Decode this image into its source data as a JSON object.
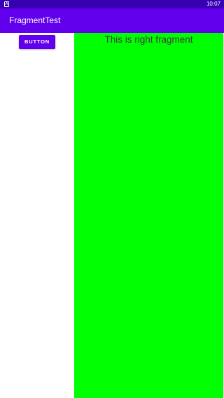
{
  "status_bar": {
    "time": "10:07",
    "left_icon": "A",
    "color": "#3700b3"
  },
  "app_bar": {
    "title": "FragmentTest",
    "color": "#6200ee"
  },
  "left_fragment": {
    "button_label": "BUTTON",
    "button_color": "#6200ee"
  },
  "right_fragment": {
    "text": "This is right fragment",
    "background": "#00ff00"
  }
}
